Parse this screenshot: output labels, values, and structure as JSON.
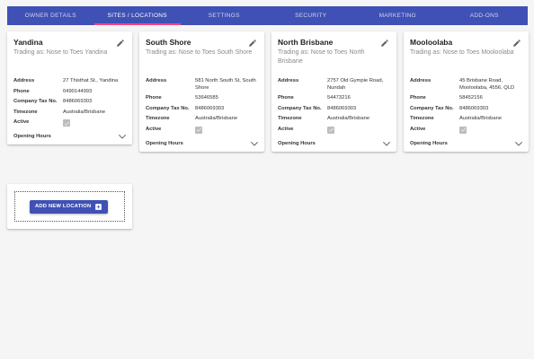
{
  "tabs": [
    {
      "label": "OWNER DETAILS",
      "active": false
    },
    {
      "label": "SITES / LOCATIONS",
      "active": true
    },
    {
      "label": "SETTINGS",
      "active": false
    },
    {
      "label": "SECURITY",
      "active": false
    },
    {
      "label": "MARKETING",
      "active": false
    },
    {
      "label": "ADD-ONS",
      "active": false
    }
  ],
  "field_labels": {
    "address": "Address",
    "phone": "Phone",
    "tax": "Company Tax No.",
    "timezone": "Timezone",
    "active": "Active",
    "hours": "Opening Hours"
  },
  "locations": [
    {
      "name": "Yandina",
      "trading": "Trading as: Nose to Toes Yandina",
      "address": "27 Thisthat St., Yandina",
      "phone": "0490144993",
      "tax": "8486069303",
      "timezone": "Australia/Brisbane",
      "active": true
    },
    {
      "name": "South Shore",
      "trading": "Trading as: Nose to Toes South Shore",
      "address": "581 North South St, South Shore",
      "phone": "53646585",
      "tax": "8486069303",
      "timezone": "Australia/Brisbane",
      "active": true
    },
    {
      "name": "North Brisbane",
      "trading": "Trading as: Nose to Toes North Brisbane",
      "address": "2757 Old Gympie Road, Nundah",
      "phone": "54473216",
      "tax": "8486069303",
      "timezone": "Australia/Brisbane",
      "active": true
    },
    {
      "name": "Mooloolaba",
      "trading": "Trading as: Nose to Toes Mooloolaba",
      "address": "45 Brisbane Road, Mooloolaba, 4556, QLD",
      "phone": "58452156",
      "tax": "8486069303",
      "timezone": "Australia/Brisbane",
      "active": true
    }
  ],
  "add_location": {
    "label": "ADD NEW LOCATION",
    "icon": "add-box-icon"
  },
  "colors": {
    "primary": "#3f51b5",
    "tab_indicator": "#ff4081",
    "background": "#f5f5f5"
  }
}
